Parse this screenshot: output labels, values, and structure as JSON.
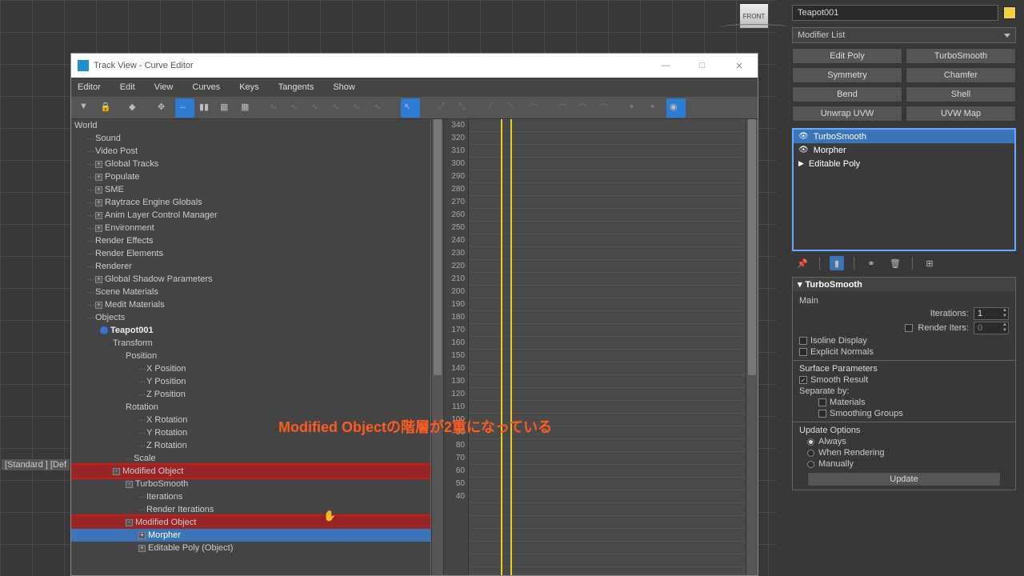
{
  "viewcube_label": "FRONT",
  "window": {
    "title": "Track View - Curve Editor",
    "menu": [
      "Editor",
      "Edit",
      "View",
      "Curves",
      "Keys",
      "Tangents",
      "Show"
    ]
  },
  "tree": [
    {
      "t": "World",
      "d": 0,
      "e": ""
    },
    {
      "t": "Sound",
      "d": 1,
      "dots": 1
    },
    {
      "t": "Video Post",
      "d": 1,
      "dots": 1
    },
    {
      "t": "Global Tracks",
      "d": 1,
      "e": "+",
      "dots": 1
    },
    {
      "t": "Populate",
      "d": 1,
      "e": "+",
      "dots": 1
    },
    {
      "t": "SME",
      "d": 1,
      "e": "+",
      "dots": 1
    },
    {
      "t": "Raytrace Engine Globals",
      "d": 1,
      "e": "+",
      "dots": 1
    },
    {
      "t": "Anim Layer Control Manager",
      "d": 1,
      "e": "+",
      "dots": 1
    },
    {
      "t": "Environment",
      "d": 1,
      "e": "+",
      "dots": 1
    },
    {
      "t": "Render Effects",
      "d": 1,
      "dots": 1
    },
    {
      "t": "Render Elements",
      "d": 1,
      "dots": 1
    },
    {
      "t": "Renderer",
      "d": 1,
      "dots": 1
    },
    {
      "t": "Global Shadow Parameters",
      "d": 1,
      "e": "+",
      "dots": 1
    },
    {
      "t": "Scene Materials",
      "d": 1,
      "dots": 1
    },
    {
      "t": "Medit Materials",
      "d": 1,
      "e": "+",
      "dots": 1
    },
    {
      "t": "Objects",
      "d": 1,
      "dots": 1
    },
    {
      "t": "Teapot001",
      "d": 2,
      "bold": 1,
      "obj": 1
    },
    {
      "t": "Transform",
      "d": 3
    },
    {
      "t": "Position",
      "d": 4
    },
    {
      "t": "X Position",
      "d": 5,
      "dots": 1
    },
    {
      "t": "Y Position",
      "d": 5,
      "dots": 1
    },
    {
      "t": "Z Position",
      "d": 5,
      "dots": 1
    },
    {
      "t": "Rotation",
      "d": 4
    },
    {
      "t": "X Rotation",
      "d": 5,
      "dots": 1
    },
    {
      "t": "Y Rotation",
      "d": 5,
      "dots": 1
    },
    {
      "t": "Z Rotation",
      "d": 5,
      "dots": 1
    },
    {
      "t": "Scale",
      "d": 4,
      "dots": 1
    },
    {
      "t": "Modified Object",
      "d": 3,
      "e": "-",
      "hl": 1
    },
    {
      "t": "TurboSmooth",
      "d": 4,
      "e": "-"
    },
    {
      "t": "Iterations",
      "d": 5,
      "dots": 1
    },
    {
      "t": "Render Iterations",
      "d": 5,
      "dots": 1
    },
    {
      "t": "Modified Object",
      "d": 4,
      "e": "-",
      "hl": 1
    },
    {
      "t": "Morpher",
      "d": 5,
      "e": "+",
      "sel": 1
    },
    {
      "t": "Editable Poly (Object)",
      "d": 5,
      "e": "+"
    }
  ],
  "ruler": [
    "340",
    "320",
    "310",
    "300",
    "290",
    "280",
    "270",
    "260",
    "250",
    "240",
    "230",
    "220",
    "210",
    "200",
    "190",
    "180",
    "170",
    "160",
    "150",
    "140",
    "130",
    "120",
    "110",
    "100",
    "90",
    "80",
    "70",
    "60",
    "50",
    "40"
  ],
  "annotation": "Modified Objectの階層が2重になっている",
  "panel": {
    "object_name": "Teapot001",
    "modifier_list_label": "Modifier List",
    "buttons": [
      "Edit Poly",
      "TurboSmooth",
      "Symmetry",
      "Chamfer",
      "Bend",
      "Shell",
      "Unwrap UVW",
      "UVW Map"
    ],
    "stack": [
      {
        "label": "TurboSmooth",
        "sel": 1,
        "eye": 1
      },
      {
        "label": "Morpher",
        "eye": 1
      },
      {
        "label": "Editable Poly",
        "caret": 1
      }
    ],
    "rollout_title": "TurboSmooth",
    "main_label": "Main",
    "iterations_label": "Iterations:",
    "iterations_value": "1",
    "render_iters_label": "Render Iters:",
    "render_iters_value": "0",
    "isoline_label": "Isoline Display",
    "explicit_label": "Explicit Normals",
    "surface_params": "Surface Parameters",
    "smooth_result": "Smooth Result",
    "separate_by": "Separate by:",
    "materials": "Materials",
    "smoothing_groups": "Smoothing Groups",
    "update_options": "Update Options",
    "always": "Always",
    "when_rendering": "When Rendering",
    "manually": "Manually",
    "update_btn": "Update"
  },
  "status_left": "[Standard ] [Def"
}
